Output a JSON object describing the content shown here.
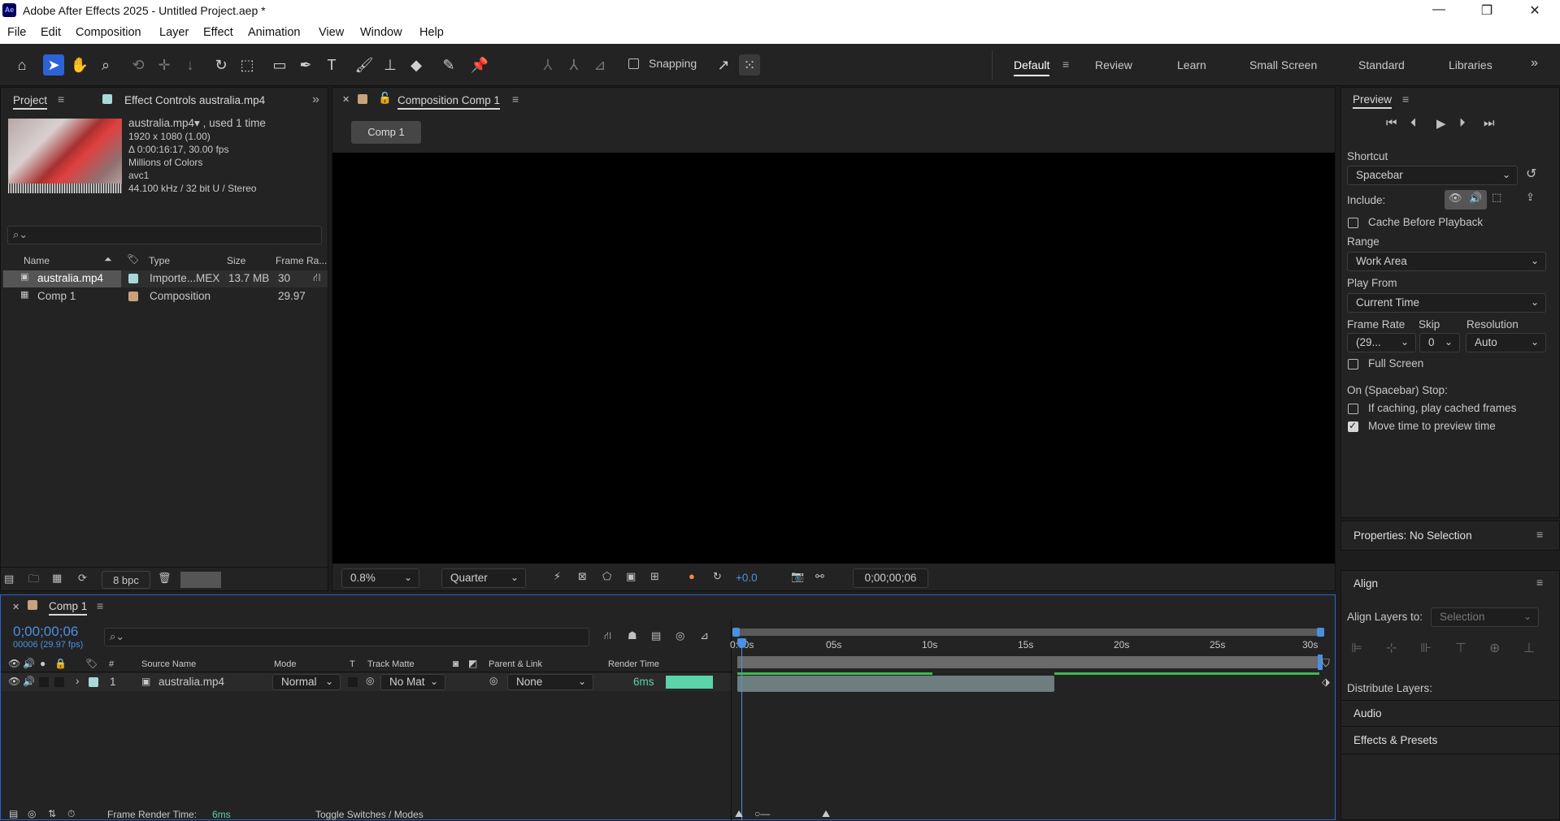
{
  "window": {
    "title": "Adobe After Effects 2025 - Untitled Project.aep *",
    "logo_text": "Ae"
  },
  "menu": [
    "File",
    "Edit",
    "Composition",
    "Layer",
    "Effect",
    "Animation",
    "View",
    "Window",
    "Help"
  ],
  "toolbar": {
    "snapping_label": "Snapping",
    "workspaces": [
      "Default",
      "Review",
      "Learn",
      "Small Screen",
      "Standard",
      "Libraries"
    ],
    "active_workspace": "Default"
  },
  "project": {
    "tab_project": "Project",
    "tab_effect_controls": "Effect Controls australia.mp4",
    "info": {
      "name": "australia.mp4▾ , used 1 time",
      "resolution": "1920 x 1080 (1.00)",
      "duration": "Δ 0:00:16:17, 30.00 fps",
      "colors": "Millions of Colors",
      "codec": "avc1",
      "audio": "44.100 kHz / 32 bit U / Stereo"
    },
    "search_placeholder": "",
    "columns": {
      "name": "Name",
      "type": "Type",
      "size": "Size",
      "frame_rate": "Frame Ra..."
    },
    "items": [
      {
        "name": "australia.mp4",
        "type": "Importe...MEX",
        "size": "13.7 MB",
        "fps": "30",
        "color": "#a8d8d8"
      },
      {
        "name": "Comp 1",
        "type": "Composition",
        "size": "",
        "fps": "29.97",
        "color": "#c9a27a"
      }
    ],
    "bpc": "8 bpc"
  },
  "composition": {
    "tab": "Composition Comp 1",
    "flow_label": "Comp 1",
    "zoom": "0.8%",
    "resolution": "Quarter",
    "exposure": "+0.0",
    "timecode": "0;00;00;06"
  },
  "preview": {
    "title": "Preview",
    "shortcut_label": "Shortcut",
    "shortcut_value": "Spacebar",
    "include_label": "Include:",
    "cache_label": "Cache Before Playback",
    "range_label": "Range",
    "range_value": "Work Area",
    "play_from_label": "Play From",
    "play_from_value": "Current Time",
    "frame_rate_label": "Frame Rate",
    "frame_rate_value": "(29...",
    "skip_label": "Skip",
    "skip_value": "0",
    "resolution_label": "Resolution",
    "resolution_value": "Auto",
    "full_screen_label": "Full Screen",
    "stop_label": "On (Spacebar) Stop:",
    "if_caching_label": "If caching, play cached frames",
    "move_time_label": "Move time to preview time"
  },
  "properties": {
    "title": "Properties: No Selection"
  },
  "align": {
    "title": "Align",
    "align_to_label": "Align Layers to:",
    "align_to_value": "Selection",
    "distribute_label": "Distribute Layers:",
    "audio": "Audio",
    "effects_presets": "Effects & Presets"
  },
  "timeline": {
    "tab": "Comp 1",
    "timecode": "0;00;00;06",
    "fps_info": "00006 (29.97 fps)",
    "columns": {
      "hash": "#",
      "source_name": "Source Name",
      "mode": "Mode",
      "t": "T",
      "track_matte": "Track Matte",
      "parent_link": "Parent & Link",
      "render_time": "Render Time"
    },
    "layer": {
      "index": "1",
      "name": "australia.mp4",
      "mode": "Normal",
      "track_matte": "No Mat",
      "parent": "None",
      "render_time": "6ms"
    },
    "ruler": [
      "0:00s",
      "05s",
      "10s",
      "15s",
      "20s",
      "25s",
      "30s"
    ],
    "frame_render_label": "Frame Render Time:",
    "frame_render_value": "6ms",
    "toggle_label": "Toggle Switches / Modes"
  }
}
